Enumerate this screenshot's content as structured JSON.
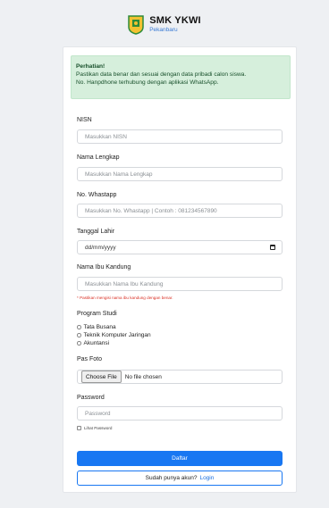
{
  "brand": {
    "name": "SMK YKWI",
    "city": "Pekanbaru",
    "color_primary": "#1877f2",
    "color_success_bg": "#d6efdc"
  },
  "alert": {
    "title": "Perhatian!",
    "line1": "Pastikan data benar dan sesuai dengan data pribadi calon siswa.",
    "line2": "No. Hanpdhone terhubung dengan aplikasi WhatsApp."
  },
  "form": {
    "nisn": {
      "label": "NISN",
      "placeholder": "Masukkan NISN"
    },
    "nama": {
      "label": "Nama Lengkap",
      "placeholder": "Masukkan Nama Lengkap"
    },
    "whatsapp": {
      "label": "No. Whastapp",
      "placeholder": "Masukkan No. Whastapp | Contoh : 081234567890"
    },
    "tanggal": {
      "label": "Tanggal Lahir",
      "placeholder": "dd/mm/yyyy",
      "icon": "calendar-icon"
    },
    "ibu": {
      "label": "Nama Ibu Kandung",
      "placeholder": "Masukkan Nama Ibu Kandung",
      "help": "* Pastikan mengisi nama ibu kandung dengan benar."
    },
    "program": {
      "label": "Program Studi",
      "options": [
        "Tata Busana",
        "Teknik Komputer Jaringan",
        "Akuntansi"
      ]
    },
    "foto": {
      "label": "Pas Foto",
      "button": "Choose File",
      "status": "No file chosen"
    },
    "password": {
      "label": "Password",
      "placeholder": "Password",
      "show_label": "Lihat Password"
    }
  },
  "actions": {
    "submit": "Daftar",
    "login_prompt": "Sudah punya akun?",
    "login_link": "Login"
  }
}
